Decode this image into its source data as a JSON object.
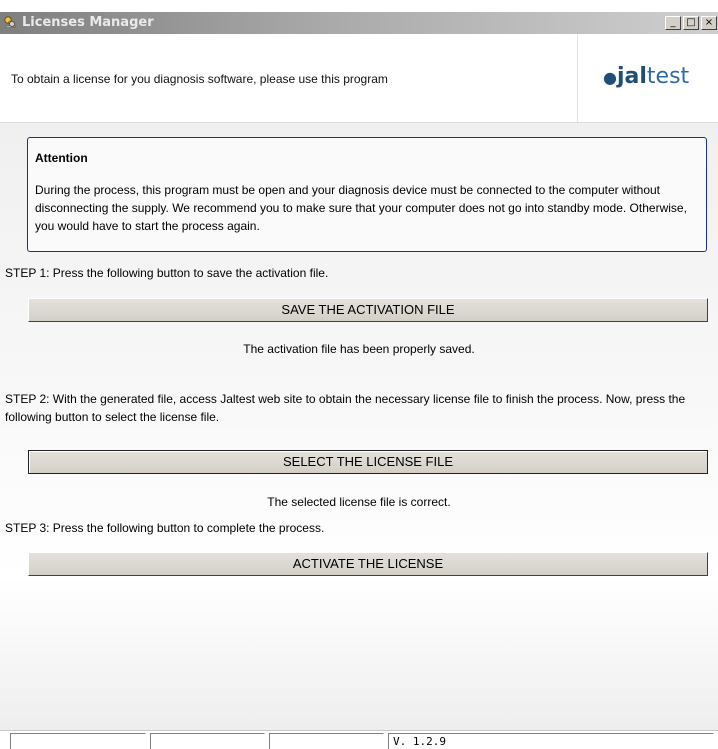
{
  "window": {
    "title": "Licenses Manager",
    "minimize_label": "_",
    "maximize_label": "□",
    "close_label": "×"
  },
  "header": {
    "description": "To obtain a license for you diagnosis software, please use this program",
    "logo": {
      "dot": "●",
      "brand_j": "j",
      "brand_al": "al",
      "brand_test": "test"
    }
  },
  "attention": {
    "title": "Attention",
    "body": "During the process, this program must be open and your diagnosis device must be connected to the computer without disconnecting the supply. We recommend you to make sure that your computer does not go into standby mode. Otherwise, you would have to start the process again."
  },
  "step1": {
    "text": "STEP 1: Press the following button to save the activation file.",
    "button_label": "SAVE THE ACTIVATION FILE",
    "status": "The activation file has been properly saved."
  },
  "step2": {
    "text": "STEP 2: With the generated file, access Jaltest web site to obtain the necessary license file to finish the process. Now, press the following button to select the license file.",
    "button_label": "SELECT THE LICENSE FILE",
    "status": "The selected license file is correct."
  },
  "step3": {
    "text": "STEP 3: Press the following button to complete the process.",
    "button_label": "ACTIVATE THE LICENSE"
  },
  "statusbar": {
    "cells": [
      "",
      "",
      "",
      ""
    ],
    "version": "V. 1.2.9"
  },
  "colors": {
    "attention_border": "#1c2f8f",
    "logo_blue": "#1f4e79",
    "button_face": "#d4d0c8"
  },
  "icons": {
    "app": "keys-icon",
    "logo_dot": "dot-icon"
  }
}
